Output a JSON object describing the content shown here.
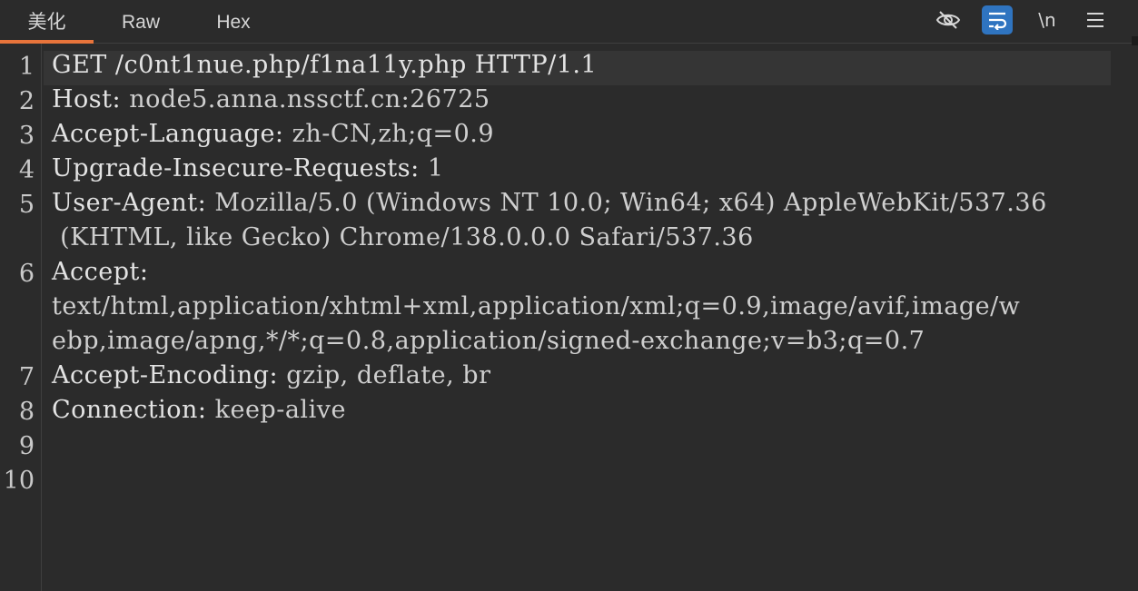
{
  "tabs": [
    "美化",
    "Raw",
    "Hex"
  ],
  "toolbar": {
    "hide_icon": "eye-slash-icon",
    "wrap_icon": "wrap-lines-icon",
    "newline_label": "\\n",
    "menu_icon": "hamburger-menu-icon"
  },
  "colors": {
    "accent": "#e8743b",
    "active_button": "#2f74c0",
    "background": "#2b2b2b"
  },
  "lines": [
    {
      "num": "1",
      "key": "GET /c0nt1nue.php/f1na11y.php HTTP/1.1",
      "val": ""
    },
    {
      "num": "2",
      "key": "Host: ",
      "val": "node5.anna.nssctf.cn:26725"
    },
    {
      "num": "3",
      "key": "Accept-Language: ",
      "val": "zh-CN,zh;q=0.9"
    },
    {
      "num": "4",
      "key": "Upgrade-Insecure-Requests: ",
      "val": "1"
    },
    {
      "num": "5",
      "key": "User-Agent: ",
      "val": "Mozilla/5.0 (Windows NT 10.0; Win64; x64) AppleWebKit/537.36",
      "cont": " (KHTML, like Gecko) Chrome/138.0.0.0 Safari/537.36"
    },
    {
      "num": "6",
      "key": "Accept:",
      "val": "",
      "cont": "text/html,application/xhtml+xml,application/xml;q=0.9,image/avif,image/w",
      "cont2": "ebp,image/apng,*/*;q=0.8,application/signed-exchange;v=b3;q=0.7"
    },
    {
      "num": "7",
      "key": "Accept-Encoding: ",
      "val": "gzip, deflate, br"
    },
    {
      "num": "8",
      "key": "Connection: ",
      "val": "keep-alive"
    },
    {
      "num": "9",
      "key": "",
      "val": ""
    },
    {
      "num": "10",
      "key": "",
      "val": ""
    }
  ]
}
